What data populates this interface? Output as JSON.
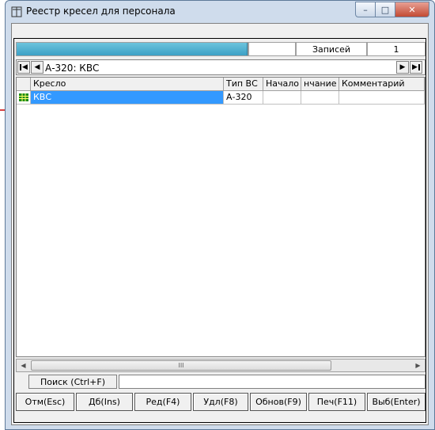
{
  "window": {
    "title": "Реестр кресел для персонала",
    "controls": {
      "minimize": "–",
      "maximize": "□",
      "close": "✕"
    }
  },
  "status": {
    "progress": 1.0,
    "records_label": "Записей",
    "records_count": "1"
  },
  "navigator": {
    "first": "◀",
    "prev": "◀",
    "next": "▶",
    "last": "▶",
    "current": "А-320: КВС"
  },
  "table": {
    "columns": [
      "Кресло",
      "Тип ВС",
      "Начало",
      "нчание",
      "Комментарий"
    ],
    "rows": [
      {
        "seat": "КВС",
        "type": "А-320",
        "start": "",
        "end": "",
        "comment": ""
      }
    ]
  },
  "scrollbar": {
    "left": "◀",
    "right": "▶",
    "grip": "III"
  },
  "search": {
    "button_label": "Поиск (Ctrl+F)",
    "value": ""
  },
  "buttons": {
    "cancel": "Отм(Esc)",
    "add": "Дб(Ins)",
    "edit": "Ред(F4)",
    "delete": "Удл(F8)",
    "refresh": "Обнов(F9)",
    "print": "Печ(F11)",
    "select": "Выб(Enter)"
  },
  "colors": {
    "selection": "#3399ff",
    "progress": "#3da1c6",
    "pointer": "#cc0000"
  }
}
